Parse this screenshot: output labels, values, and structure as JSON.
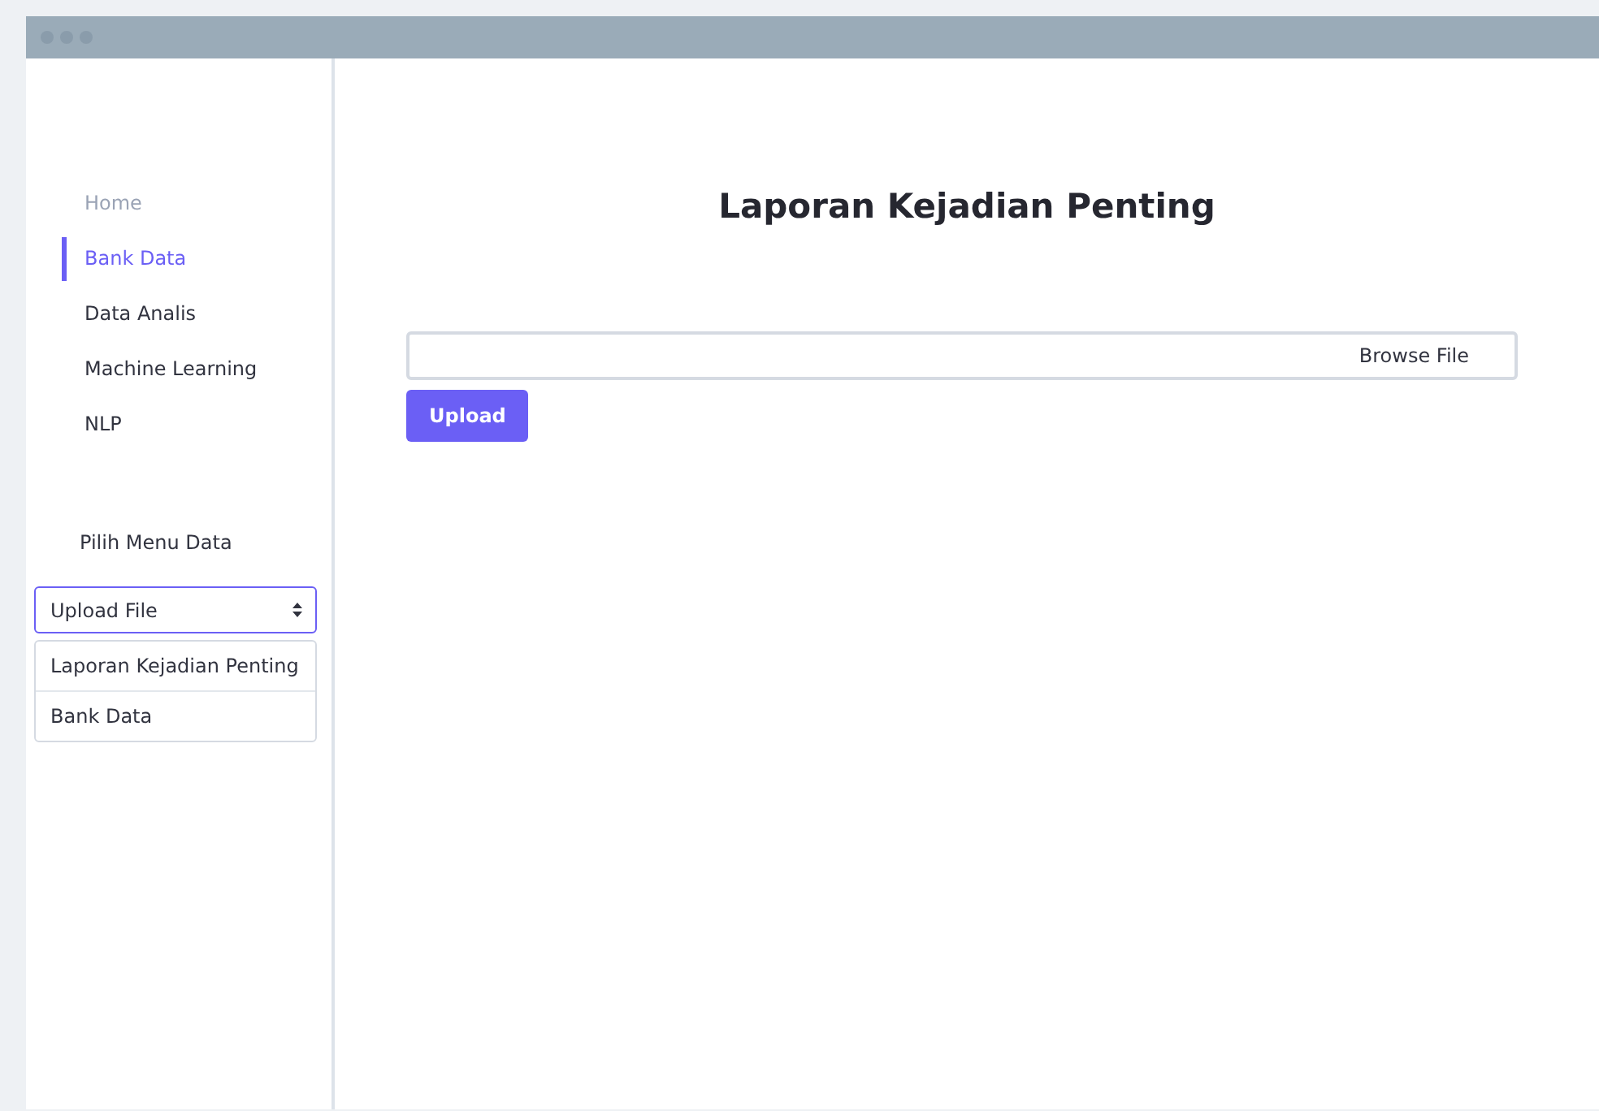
{
  "nav": [
    {
      "label": "Home",
      "selected": false,
      "disabled": true
    },
    {
      "label": "Bank Data",
      "selected": true,
      "disabled": false
    },
    {
      "label": "Data Analis",
      "selected": false,
      "disabled": false
    },
    {
      "label": "Machine Learning",
      "selected": false,
      "disabled": false
    },
    {
      "label": "NLP",
      "selected": false,
      "disabled": false
    }
  ],
  "menu_label": "Pilih Menu Data",
  "select": {
    "value": "Upload File",
    "expanded": true,
    "options": [
      "Laporan Kejadian Penting",
      "Bank Data"
    ]
  },
  "main": {
    "title": "Laporan Kejadian Penting",
    "file_button": "Browse File",
    "upload_button": "Upload"
  }
}
